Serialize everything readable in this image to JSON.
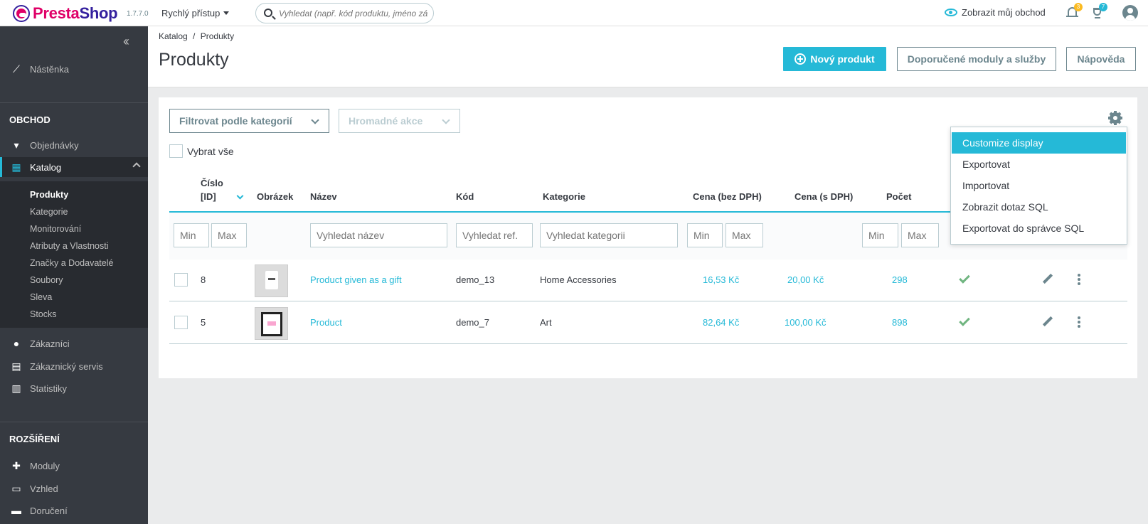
{
  "topbar": {
    "brand_presta": "Presta",
    "brand_shop": "Shop",
    "version": "1.7.7.0",
    "quick_access": "Rychlý přístup",
    "search_placeholder": "Vyhledat (např. kód produktu, jméno zá",
    "view_shop": "Zobrazit můj obchod",
    "notifications_count": "3",
    "orders_count": "7"
  },
  "sidebar": {
    "dashboard": "Nástěnka",
    "section_shop": "OBCHOD",
    "orders": "Objednávky",
    "catalog": "Katalog",
    "catalog_sub": [
      "Produkty",
      "Kategorie",
      "Monitorování",
      "Atributy a Vlastnosti",
      "Značky a Dodavatelé",
      "Soubory",
      "Sleva",
      "Stocks"
    ],
    "customers": "Zákazníci",
    "customer_service": "Zákaznický servis",
    "stats": "Statistiky",
    "section_extensions": "ROZŠÍŘENÍ",
    "modules": "Moduly",
    "design": "Vzhled",
    "shipping": "Doručení"
  },
  "header": {
    "breadcrumb_catalog": "Katalog",
    "breadcrumb_sep": "/",
    "breadcrumb_products": "Produkty",
    "title": "Produkty",
    "new_product": "Nový produkt",
    "recommended": "Doporučené moduly a služby",
    "help": "Nápověda"
  },
  "toolbar": {
    "filter_categories": "Filtrovat podle kategorií",
    "bulk_actions": "Hromadné akce",
    "select_all": "Vybrat vše"
  },
  "table": {
    "col_id_line1": "Číslo",
    "col_id_line2": "[ID]",
    "col_image": "Obrázek",
    "col_name": "Název",
    "col_ref": "Kód",
    "col_category": "Kategorie",
    "col_price_excl": "Cena (bez DPH)",
    "col_price_incl": "Cena (s DPH)",
    "col_qty": "Počet",
    "filters": {
      "min": "Min",
      "max": "Max",
      "name": "Vyhledat název",
      "ref": "Vyhledat ref.",
      "category": "Vyhledat kategorii"
    },
    "rows": [
      {
        "id": "8",
        "name": "Product given as a gift",
        "ref": "demo_13",
        "category": "Home Accessories",
        "price_excl": "16,53 Kč",
        "price_incl": "20,00 Kč",
        "qty": "298"
      },
      {
        "id": "5",
        "name": "Product",
        "ref": "demo_7",
        "category": "Art",
        "price_excl": "82,64 Kč",
        "price_incl": "100,00 Kč",
        "qty": "898"
      }
    ]
  },
  "dropdown": {
    "items": [
      "Customize display",
      "Exportovat",
      "Importovat",
      "Zobrazit dotaz SQL",
      "Exportovat do správce SQL"
    ]
  }
}
